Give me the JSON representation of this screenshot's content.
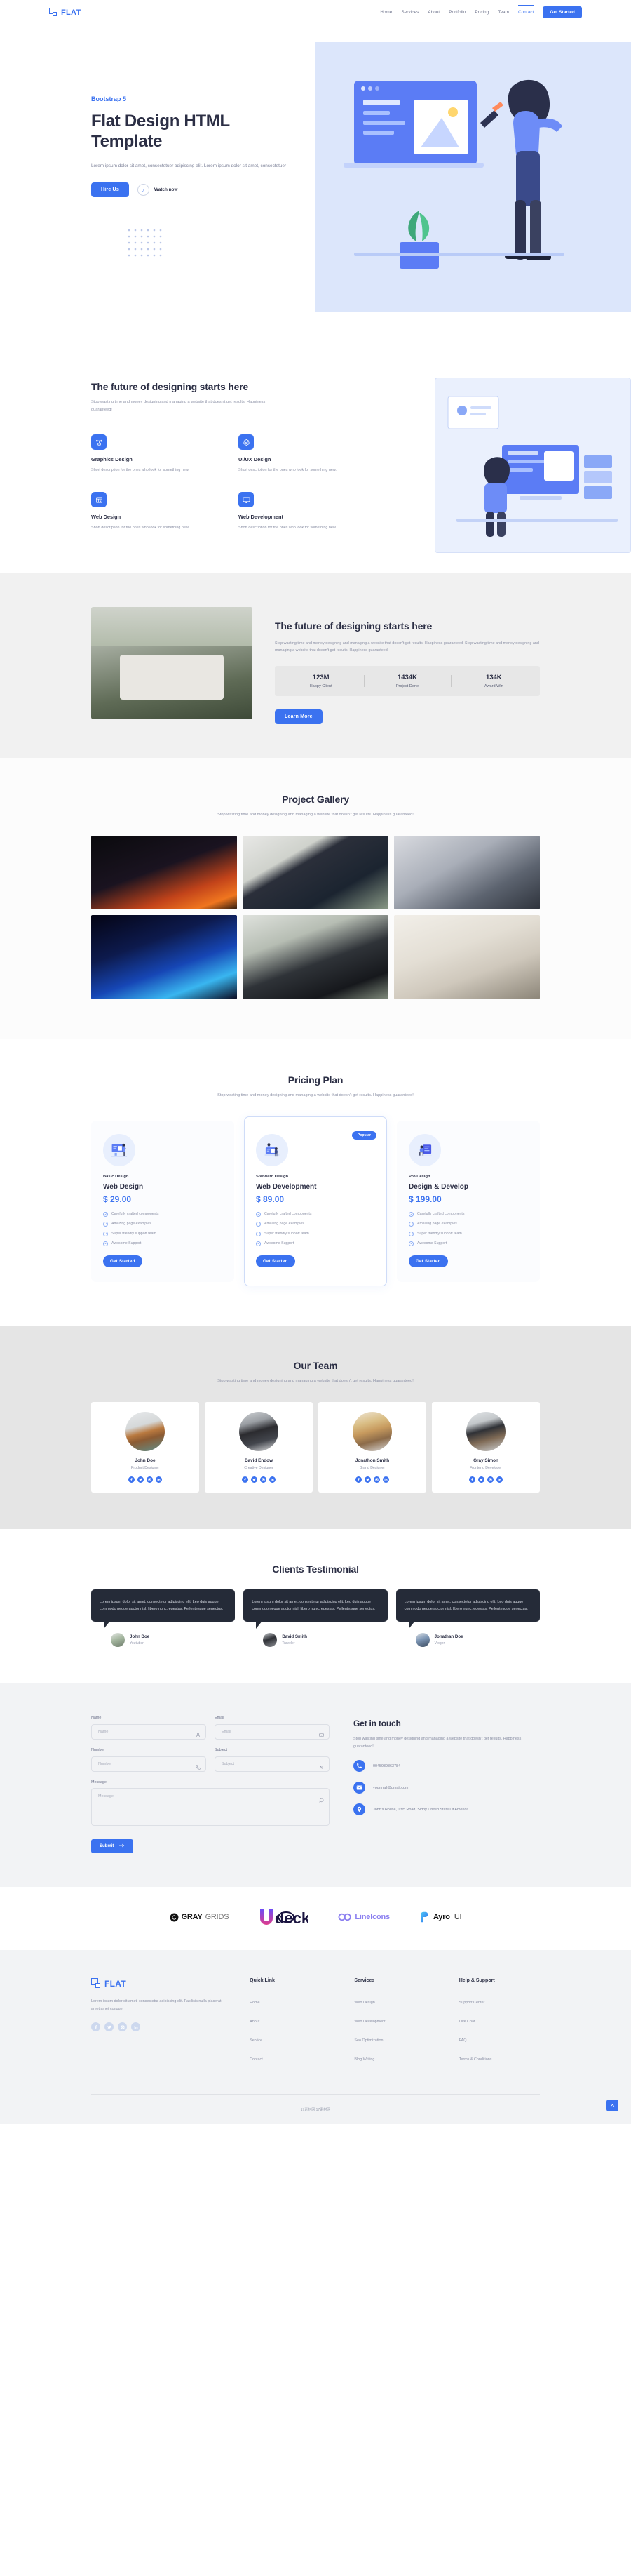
{
  "header": {
    "brand": "FLAT",
    "nav": [
      {
        "label": "Home",
        "active": false
      },
      {
        "label": "Services",
        "active": false
      },
      {
        "label": "About",
        "active": false
      },
      {
        "label": "Portfolio",
        "active": false
      },
      {
        "label": "Pricing",
        "active": false
      },
      {
        "label": "Team",
        "active": false
      },
      {
        "label": "Contact",
        "active": true
      }
    ],
    "cta": "Get Started"
  },
  "hero": {
    "eyebrow": "Bootstrap 5",
    "title": "Flat Design HTML Template",
    "subtitle": "Lorem ipsum dolor sit amet, consectetuer adipiscing elit. Lorem ipsum dolor sit amet, consectetuer",
    "primary_cta": "Hire Us",
    "watch_label": "Watch now"
  },
  "features": {
    "title": "The future of designing starts here",
    "subtitle": "Stop wasting time and money designing and managing a website that doesn't get results. Happiness guaranteed!",
    "items": [
      {
        "icon": "graphics-design-icon",
        "name": "Graphics Design",
        "desc": "Short description for the ones who look for something new."
      },
      {
        "icon": "ui-ux-design-icon",
        "name": "UI/UX Design",
        "desc": "Short description for the ones who look for something new."
      },
      {
        "icon": "web-design-icon",
        "name": "Web Design",
        "desc": "Short description for the ones who look for something new."
      },
      {
        "icon": "web-development-icon",
        "name": "Web Development",
        "desc": "Short description for the ones who look for something new."
      }
    ]
  },
  "about": {
    "title": "The future of designing starts here",
    "desc": "Stop wasting time and money designing and managing a website that doesn't get results. Happiness guaranteed, Stop wasting time and money designing and managing a website that doesn't get results. Happiness guaranteed,",
    "stats": [
      {
        "value": "123M",
        "label": "Happy Client"
      },
      {
        "value": "1434K",
        "label": "Project Done"
      },
      {
        "value": "134K",
        "label": "Award Win"
      }
    ],
    "cta": "Learn More"
  },
  "gallery": {
    "title": "Project Gallery",
    "subtitle": "Stop wasting time and money designing and managing a website that doesn't get results. Happiness guaranteed!"
  },
  "pricing": {
    "title": "Pricing Plan",
    "subtitle": "Stop wasting time and money designing and managing a website that doesn't get results. Happiness guaranteed!",
    "popular_badge": "Popular",
    "plans": [
      {
        "category": "Basic Design",
        "name": "Web Design",
        "price": "$ 29.00",
        "features": [
          "Carefully crafted components",
          "Amazing page examples",
          "Super friendly support team",
          "Awesome Support"
        ],
        "cta": "Get Started",
        "featured": false
      },
      {
        "category": "Standard Design",
        "name": "Web Development",
        "price": "$ 89.00",
        "features": [
          "Carefully crafted components",
          "Amazing page examples",
          "Super friendly support team",
          "Awesome Support"
        ],
        "cta": "Get Started",
        "featured": true
      },
      {
        "category": "Pro Design",
        "name": "Design & Develop",
        "price": "$ 199.00",
        "features": [
          "Carefully crafted components",
          "Amazing page examples",
          "Super friendly support team",
          "Awesome Support"
        ],
        "cta": "Get Started",
        "featured": false
      }
    ]
  },
  "team": {
    "title": "Our Team",
    "subtitle": "Stop wasting time and money designing and managing a website that doesn't get results. Happiness guaranteed!",
    "members": [
      {
        "name": "John Doe",
        "role": "Product Designer"
      },
      {
        "name": "David Endow",
        "role": "Creative Designer"
      },
      {
        "name": "Jonathon Smith",
        "role": "Brand Designer"
      },
      {
        "name": "Gray Simon",
        "role": "Frontend Developer"
      }
    ],
    "social_icons": [
      "facebook-icon",
      "twitter-icon",
      "instagram-icon",
      "linkedin-icon"
    ]
  },
  "testimonials": {
    "title": "Clients Testimonial",
    "items": [
      {
        "quote": "Lorem ipsum dolor sit amet, consectetur adipiscing elit. Leo duis augue commodo neque auctor nisl, libero nunc, egestas. Pellentesque senectus.",
        "name": "John Doe",
        "role": "Youtuber"
      },
      {
        "quote": "Lorem ipsum dolor sit amet, consectetur adipiscing elit. Leo duis augue commodo neque auctor nisl, libero nunc, egestas. Pellentesque senectus.",
        "name": "David Smith",
        "role": "Traveler"
      },
      {
        "quote": "Lorem ipsum dolor sit amet, consectetur adipiscing elit. Leo duis augue commodo neque auctor nisl, libero nunc, egestas. Pellentesque senectus.",
        "name": "Jonathan Doe",
        "role": "Vloger"
      }
    ]
  },
  "contact": {
    "title": "Get in touch",
    "desc": "Stop wasting time and money designing and managing a website that doesn't get results. Happiness guaranteed!",
    "fields": {
      "name_label": "Name",
      "name_placeholder": "Name",
      "email_label": "Email",
      "email_placeholder": "Email",
      "number_label": "Number",
      "number_placeholder": "Number",
      "subject_label": "Subject",
      "subject_placeholder": "Subject",
      "message_label": "Message",
      "message_placeholder": "Message"
    },
    "submit": "Submit",
    "phone": "0045939863784",
    "email": "yourmail@gmail.com",
    "address": "John's House, 13/5 Road, Sidny United State Of America"
  },
  "clients": {
    "logos": [
      {
        "name": "GrayGrids",
        "text_bold": "GRAY",
        "text_light": "GRIDS"
      },
      {
        "name": "UIdeck",
        "text": "UIdeck"
      },
      {
        "name": "LineIcons",
        "text": "LineIcons"
      },
      {
        "name": "Ayro UI",
        "text_bold": "Ayro",
        "text_light": "UI"
      }
    ]
  },
  "footer": {
    "brand": "FLAT",
    "desc": "Lorem ipsum dolor sit amet, consectetur adipiscing elit. Facilisis nulla placerat amet amet congue.",
    "social_icons": [
      "facebook-icon",
      "twitter-icon",
      "instagram-icon",
      "linkedin-icon"
    ],
    "columns": [
      {
        "title": "Quick Link",
        "links": [
          "Home",
          "About",
          "Service",
          "Contact"
        ]
      },
      {
        "title": "Services",
        "links": [
          "Web Design",
          "Web Development",
          "Seo Optimization",
          "Blog Writing"
        ]
      },
      {
        "title": "Help & Support",
        "links": [
          "Support Center",
          "Live Chat",
          "FAQ",
          "Terms & Conditions"
        ]
      }
    ],
    "copyright": "17素材网 17素材网"
  },
  "colors": {
    "accent": "#3b72f0",
    "dark": "#2c2f45",
    "muted": "#8b90a5",
    "bubble": "#252b38"
  }
}
